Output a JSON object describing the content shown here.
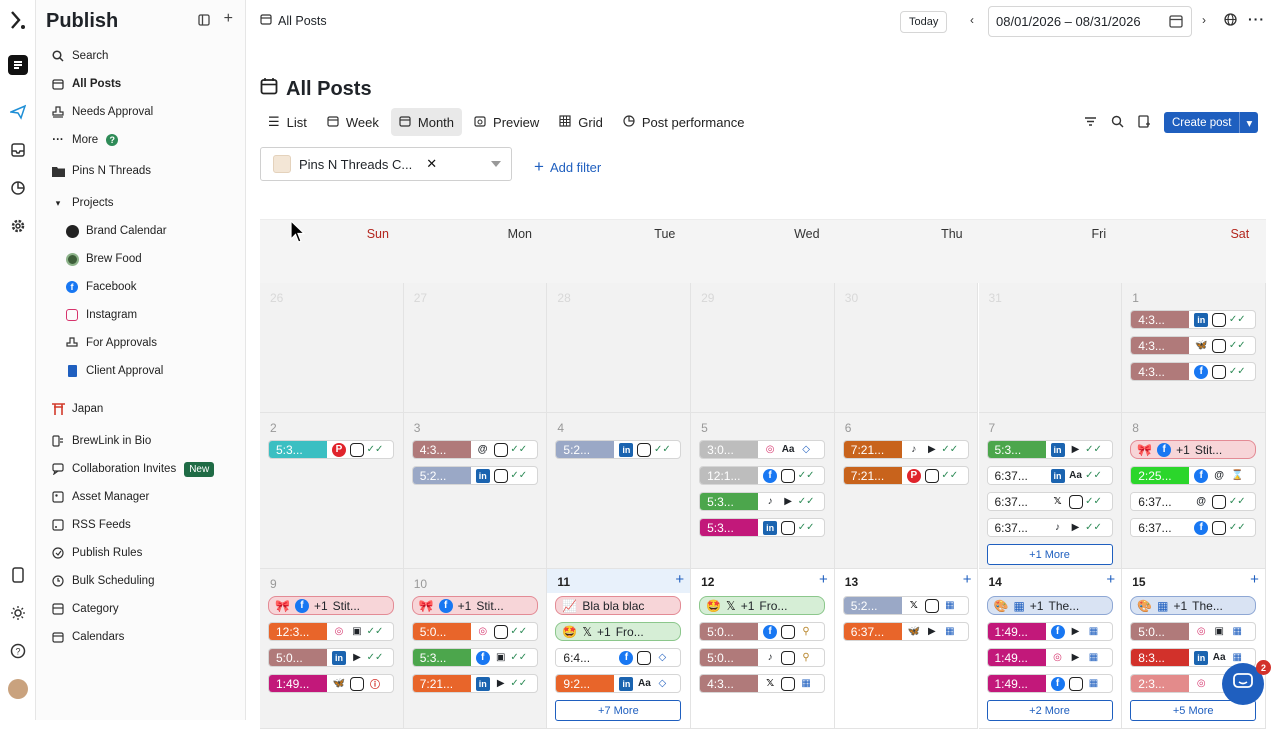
{
  "sidebar": {
    "title": "Publish",
    "items": [
      {
        "label": "Search",
        "icon": "search-icon"
      },
      {
        "label": "All Posts",
        "icon": "calendar-icon"
      },
      {
        "label": "Needs Approval",
        "icon": "stamp-icon"
      },
      {
        "label": "More",
        "icon": "more-icon"
      },
      {
        "label": "Pins N Threads",
        "icon": "folder-icon"
      },
      {
        "label": "Projects",
        "icon": "chevron-down-icon"
      },
      {
        "label": "Brand Calendar",
        "icon": "brand-avatar-icon"
      },
      {
        "label": "Brew Food",
        "icon": "brew-avatar-icon"
      },
      {
        "label": "Facebook",
        "icon": "facebook-icon"
      },
      {
        "label": "Instagram",
        "icon": "instagram-icon"
      },
      {
        "label": "For Approvals",
        "icon": "stamp-icon"
      },
      {
        "label": "Client Approval",
        "icon": "book-icon"
      },
      {
        "label": "Japan",
        "icon": "torii-icon"
      },
      {
        "label": "BrewLink in Bio",
        "icon": "link-icon"
      },
      {
        "label": "Collaboration Invites",
        "icon": "chat-icon",
        "badge": "New"
      },
      {
        "label": "Asset Manager",
        "icon": "image-icon"
      },
      {
        "label": "RSS Feeds",
        "icon": "rss-icon"
      },
      {
        "label": "Publish Rules",
        "icon": "rules-icon"
      },
      {
        "label": "Bulk Scheduling",
        "icon": "bulk-icon"
      },
      {
        "label": "Category",
        "icon": "category-icon"
      },
      {
        "label": "Calendars",
        "icon": "calendar-icon"
      }
    ]
  },
  "topbar": {
    "breadcrumb": "All Posts",
    "today": "Today",
    "date_range": "08/01/2026  – 08/31/2026"
  },
  "page": {
    "title": "All Posts",
    "tabs": [
      "List",
      "Week",
      "Month",
      "Preview",
      "Grid",
      "Post performance"
    ],
    "active_tab": "Month",
    "create_post": "Create post",
    "filter_value": "Pins N Threads C...",
    "add_filter": "Add filter"
  },
  "calendar": {
    "days": [
      "Sun",
      "Mon",
      "Tue",
      "Wed",
      "Thu",
      "Fri",
      "Sat"
    ],
    "weeks": [
      {
        "dates": [
          "26",
          "27",
          "28",
          "29",
          "30",
          "31",
          "1"
        ]
      },
      {
        "dates": [
          "2",
          "3",
          "4",
          "5",
          "6",
          "7",
          "8"
        ]
      },
      {
        "dates": [
          "9",
          "10",
          "11",
          "12",
          "13",
          "14",
          "15"
        ]
      }
    ],
    "more": {
      "fri7": "+1 More",
      "tue11": "+7 More",
      "fri14": "+2 More",
      "sat15": "+5 More"
    }
  },
  "posts": {
    "sat1": [
      "4:3...",
      "4:3...",
      "4:3..."
    ],
    "sun2": [
      "5:3..."
    ],
    "mon3": [
      "4:3...",
      "5:2..."
    ],
    "tue4": [
      "5:2..."
    ],
    "wed5": [
      "3:0...",
      "12:1...",
      "5:3...",
      "5:3..."
    ],
    "thu6": [
      "7:21...",
      "7:21..."
    ],
    "fri7": [
      "5:3...",
      "6:37...",
      "6:37...",
      "6:37..."
    ],
    "sat8": [
      "Stit...",
      "2:25...",
      "6:37...",
      "6:37..."
    ],
    "sun9": [
      "Stit...",
      "12:3...",
      "5:0...",
      "1:49..."
    ],
    "mon10": [
      "Stit...",
      "5:0...",
      "5:3...",
      "7:21..."
    ],
    "tue11": [
      "Bla bla blac",
      "Fro...",
      "6:4...",
      "9:2..."
    ],
    "wed12": [
      "Fro...",
      "5:0...",
      "5:0...",
      "4:3..."
    ],
    "thu13": [
      "5:2...",
      "6:37..."
    ],
    "fri14": [
      "The...",
      "1:49...",
      "1:49...",
      "1:49..."
    ],
    "sat15": [
      "The...",
      "5:0...",
      "8:3...",
      "2:3..."
    ],
    "plus_one": "+1"
  },
  "chat_badge": "2"
}
